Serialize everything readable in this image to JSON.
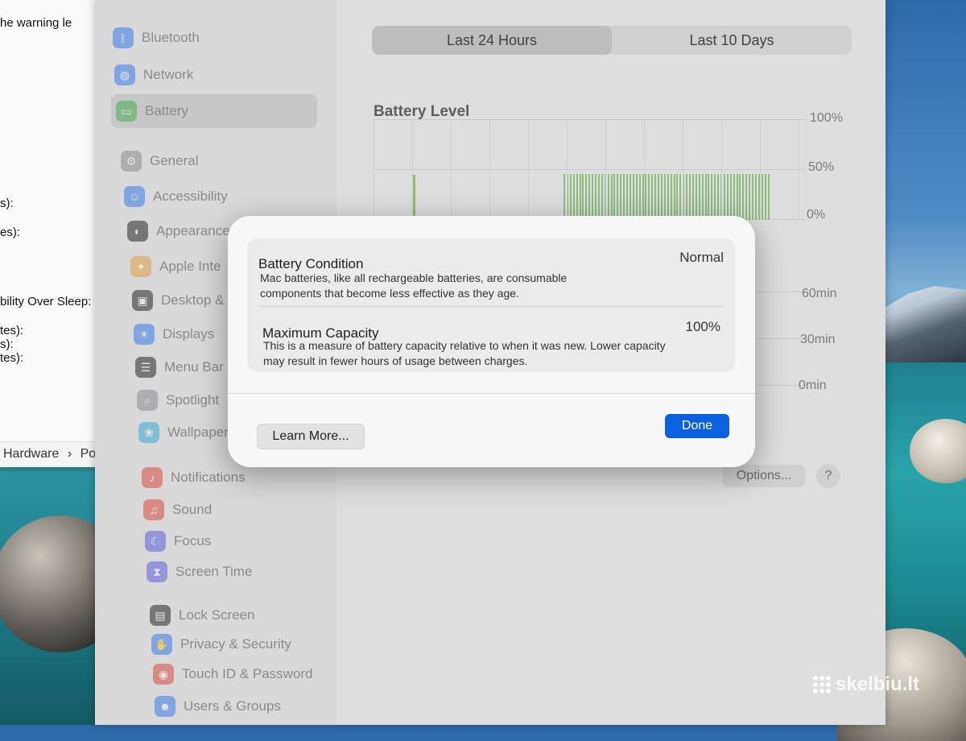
{
  "document": {
    "lines": [
      "he warning le",
      "s):",
      "es):",
      "bility Over Sleep:",
      "tes):",
      "s):",
      "tes):"
    ],
    "breadcrumb": [
      "Hardware",
      "›",
      "Powe"
    ]
  },
  "sidebar": {
    "items": [
      {
        "label": "Bluetooth",
        "icon": "bluetooth-icon",
        "color": "#2f7cf6"
      },
      {
        "label": "Network",
        "icon": "globe-icon",
        "color": "#2f7cf6"
      },
      {
        "label": "Battery",
        "icon": "battery-icon",
        "color": "#3fb34f"
      },
      {
        "label": "General",
        "icon": "gear-icon",
        "color": "#8e8e93"
      },
      {
        "label": "Accessibility",
        "icon": "accessibility-icon",
        "color": "#2f7cf6"
      },
      {
        "label": "Appearance",
        "icon": "appearance-icon",
        "color": "#1c1c1e"
      },
      {
        "label": "Apple Inte",
        "icon": "sparkle-icon",
        "color": "#f0a23a"
      },
      {
        "label": "Desktop &",
        "icon": "desktop-icon",
        "color": "#1c1c1e"
      },
      {
        "label": "Displays",
        "icon": "sun-icon",
        "color": "#2f7cf6"
      },
      {
        "label": "Menu Bar",
        "icon": "menubar-icon",
        "color": "#1c1c1e"
      },
      {
        "label": "Spotlight",
        "icon": "search-icon",
        "color": "#8e8e93"
      },
      {
        "label": "Wallpaper",
        "icon": "wallpaper-icon",
        "color": "#2fb0e0"
      },
      {
        "label": "Notifications",
        "icon": "bell-icon",
        "color": "#e5443b"
      },
      {
        "label": "Sound",
        "icon": "speaker-icon",
        "color": "#e5443b"
      },
      {
        "label": "Focus",
        "icon": "moon-icon",
        "color": "#5e5ce6"
      },
      {
        "label": "Screen Time",
        "icon": "hourglass-icon",
        "color": "#5e5ce6"
      },
      {
        "label": "Lock Screen",
        "icon": "lock-icon",
        "color": "#1c1c1e"
      },
      {
        "label": "Privacy & Security",
        "icon": "hand-icon",
        "color": "#2f7cf6"
      },
      {
        "label": "Touch ID & Password",
        "icon": "fingerprint-icon",
        "color": "#e5443b"
      },
      {
        "label": "Users & Groups",
        "icon": "users-icon",
        "color": "#2f7cf6"
      }
    ]
  },
  "main": {
    "segments": [
      "Last 24 Hours",
      "Last 10 Days"
    ],
    "active_segment": 0,
    "chart_title": "Battery Level",
    "level_axis": [
      "100%",
      "50%",
      "0%"
    ],
    "time_axis": [
      "60min",
      "30min",
      "0min"
    ],
    "options_label": "Options...",
    "help_label": "?"
  },
  "chart_data": {
    "type": "bar",
    "title": "Battery Level",
    "ylim": [
      0,
      100
    ],
    "y_ticks": [
      "100%",
      "50%",
      "0%"
    ],
    "values": [
      45,
      46,
      46,
      46,
      46,
      46,
      46,
      46,
      46,
      46,
      46,
      46,
      46,
      46,
      46,
      46,
      46,
      46,
      46,
      46,
      46,
      46,
      46,
      46,
      46,
      46,
      46,
      46,
      46,
      46,
      46,
      46,
      46,
      46,
      46,
      46,
      46,
      46,
      46,
      46,
      46,
      46,
      46,
      46,
      46,
      46,
      46,
      46,
      46,
      46,
      46,
      46,
      46,
      46,
      46,
      46,
      46,
      46,
      46,
      46,
      46,
      46,
      46,
      46,
      46,
      46,
      46
    ]
  },
  "dialog": {
    "battery_condition": {
      "title": "Battery Condition",
      "value": "Normal",
      "description": "Mac batteries, like all rechargeable batteries, are consumable components that become less effective as they age."
    },
    "maximum_capacity": {
      "title": "Maximum Capacity",
      "value": "100%",
      "description": "This is a measure of battery capacity relative to when it was new. Lower capacity may result in fewer hours of usage between charges."
    },
    "learn_more_label": "Learn More...",
    "done_label": "Done"
  },
  "watermark": "skelbiu.lt"
}
